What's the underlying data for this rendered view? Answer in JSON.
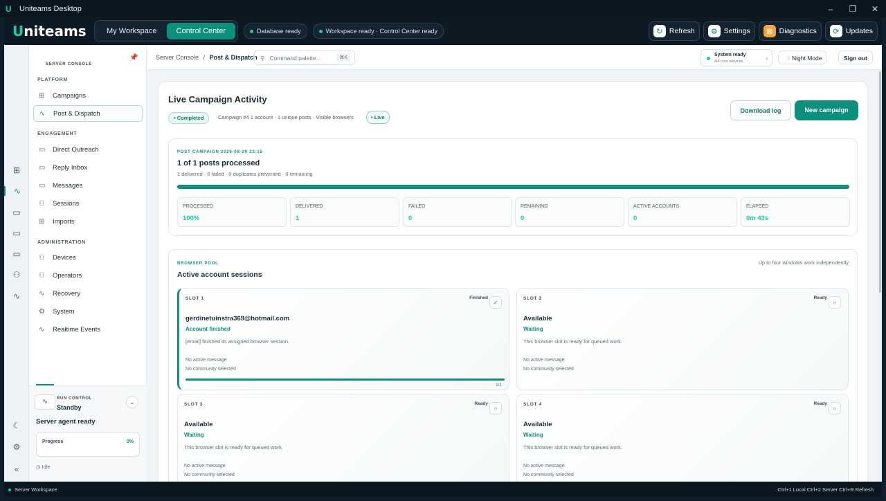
{
  "window": {
    "title": "Uniteams Desktop",
    "logo_glyph": "U",
    "controls": [
      "–",
      "❐",
      "✕"
    ]
  },
  "header": {
    "brand_prefix": "U",
    "brand_rest": "niteams",
    "tabs": [
      {
        "label": "My Workspace",
        "active": false
      },
      {
        "label": "Control Center",
        "active": true
      }
    ],
    "status_pills": [
      "Database ready",
      "Workspace ready · Control Center ready"
    ],
    "buttons": [
      {
        "label": "Refresh",
        "icon": "refresh-icon",
        "glyph": "↻"
      },
      {
        "label": "Settings",
        "icon": "gear-icon",
        "glyph": "⚙"
      },
      {
        "label": "Diagnostics",
        "icon": "diagnostics-icon",
        "glyph": "⊠"
      },
      {
        "label": "Updates",
        "icon": "updates-icon",
        "glyph": "⟳"
      }
    ]
  },
  "rail": {
    "icons": [
      {
        "name": "grid-icon",
        "glyph": "⊞"
      },
      {
        "name": "pulse-icon",
        "glyph": "∿"
      },
      {
        "name": "chat-icon",
        "glyph": "▭"
      },
      {
        "name": "chat-icon",
        "glyph": "▭"
      },
      {
        "name": "chat-icon",
        "glyph": "▭"
      },
      {
        "name": "users-icon",
        "glyph": "⚇"
      },
      {
        "name": "pulse-icon",
        "glyph": "∿"
      }
    ],
    "bottom": [
      {
        "name": "moon-icon",
        "glyph": "☾"
      },
      {
        "name": "gear-icon",
        "glyph": "⚙"
      },
      {
        "name": "collapse-icon",
        "glyph": "«"
      }
    ]
  },
  "sidebar": {
    "title": "SERVER CONSOLE",
    "sections": [
      {
        "label": "PLATFORM"
      },
      {
        "label": "ENGAGEMENT"
      },
      {
        "label": "ADMINISTRATION"
      }
    ],
    "items": [
      {
        "label": "Campaigns",
        "glyph": "⊞"
      },
      {
        "label": "Post & Dispatch",
        "glyph": "∿"
      },
      {
        "label": "Direct Outreach",
        "glyph": "▭"
      },
      {
        "label": "Reply Inbox",
        "glyph": "▭"
      },
      {
        "label": "Messages",
        "glyph": "▭"
      },
      {
        "label": "Sessions",
        "glyph": "⚇"
      },
      {
        "label": "Imports",
        "glyph": "⊞"
      },
      {
        "label": "Devices",
        "glyph": "⚇"
      },
      {
        "label": "Operators",
        "glyph": "⚇"
      },
      {
        "label": "Recovery",
        "glyph": "∿"
      },
      {
        "label": "System",
        "glyph": "⚙"
      },
      {
        "label": "Realtime Events",
        "glyph": "∿"
      }
    ],
    "run_control": {
      "title": "RUN CONTROL",
      "value": "Standby",
      "agent": "Server agent ready",
      "progress_label": "Progress",
      "progress_value": "0%",
      "status": "Idle"
    }
  },
  "topbar": {
    "breadcrumb_root": "Server Console",
    "breadcrumb_sep": "/",
    "breadcrumb_current": "Post & Dispatch",
    "command_placeholder": "Command palette...",
    "command_shortcut": "⌘K",
    "system_status": "System ready",
    "system_sub": "4/4 core services",
    "night_mode": "Night Mode",
    "sign_out": "Sign out"
  },
  "activity": {
    "title": "Live Campaign Activity",
    "badge": "• Completed",
    "meta": "Campaign #4   1 account · 1 unique posts · Visible browsers",
    "live": "• Live",
    "download_log": "Download log",
    "new_campaign": "New campaign"
  },
  "post_campaign": {
    "kicker": "POST CAMPAIGN 2026-08-29 23:15",
    "title": "1 of 1 posts processed",
    "summary": "1 delivered · 0 failed · 0 duplicates prevented · 0 remaining",
    "progress": 1.0,
    "stats": [
      {
        "label": "PROCESSED",
        "value": "100%"
      },
      {
        "label": "DELIVERED",
        "value": "1"
      },
      {
        "label": "FAILED",
        "value": "0"
      },
      {
        "label": "REMAINING",
        "value": "0"
      },
      {
        "label": "ACTIVE ACCOUNTS",
        "value": "0"
      },
      {
        "label": "ELAPSED",
        "value": "0m 43s"
      }
    ]
  },
  "browser_pool": {
    "kicker": "BROWSER POOL",
    "title": "Active account sessions",
    "note": "Up to four windows work independently",
    "slots": [
      {
        "label": "SLOT 1",
        "status": "Finished",
        "status_glyph": "✓",
        "name": "gerdinetuinstra369@hotmail.com",
        "state": "Account finished",
        "desc": "[email] finished its assigned browser session.",
        "message": "No active message",
        "community": "No community selected",
        "progress": 1.0,
        "count": "1/1"
      },
      {
        "label": "SLOT 2",
        "status": "Ready",
        "status_glyph": "○",
        "name": "Available",
        "state": "Waiting",
        "desc": "This browser slot is ready for queued work.",
        "message": "No active message",
        "community": "No community selected"
      },
      {
        "label": "SLOT 3",
        "status": "Ready",
        "status_glyph": "○",
        "name": "Available",
        "state": "Waiting",
        "desc": "This browser slot is ready for queued work.",
        "message": "No active message",
        "community": "No community selected"
      },
      {
        "label": "SLOT 4",
        "status": "Ready",
        "status_glyph": "○",
        "name": "Available",
        "state": "Waiting",
        "desc": "This browser slot is ready for queued work.",
        "message": "No active message",
        "community": "No community selected"
      }
    ]
  },
  "footer": {
    "left": "Server Workspace",
    "right": "Ctrl+1 Local    Ctrl+2 Server    Ctrl+R Refresh"
  },
  "colors": {
    "accent": "#0c8f7c",
    "accent_bright": "#1fc9a6",
    "dark": "#0d1a24"
  }
}
